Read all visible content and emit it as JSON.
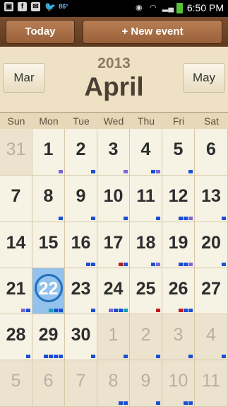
{
  "status_bar": {
    "time": "6:50 PM",
    "left_icons": [
      "image-icon",
      "facebook-icon",
      "mail-icon",
      "twitter-icon",
      "weather-icon"
    ],
    "temperature": "86°",
    "right_icons": [
      "eye-icon",
      "wifi-icon",
      "signal-icon",
      "battery-icon"
    ]
  },
  "toolbar": {
    "today_label": "Today",
    "new_event_label": "+ New event"
  },
  "header": {
    "prev_label": "Mar",
    "next_label": "May",
    "year": "2013",
    "month": "April"
  },
  "weekdays": [
    "Sun",
    "Mon",
    "Tue",
    "Wed",
    "Thu",
    "Fri",
    "Sat"
  ],
  "colors": {
    "blue": "#1a4fd6",
    "purple": "#7a66d9",
    "red": "#c21b1b",
    "teal": "#14a0b4",
    "today_bg": "#93c2ec",
    "today_ring": "#1f6fc0"
  },
  "weeks": [
    [
      {
        "day": "31",
        "other": true,
        "dots": []
      },
      {
        "day": "1",
        "other": false,
        "dots": [
          "purple"
        ]
      },
      {
        "day": "2",
        "other": false,
        "dots": [
          "blue"
        ]
      },
      {
        "day": "3",
        "other": false,
        "dots": [
          "purple"
        ]
      },
      {
        "day": "4",
        "other": false,
        "dots": [
          "blue",
          "purple"
        ]
      },
      {
        "day": "5",
        "other": false,
        "dots": [
          "blue"
        ]
      },
      {
        "day": "6",
        "other": false,
        "dots": []
      }
    ],
    [
      {
        "day": "7",
        "other": false,
        "dots": []
      },
      {
        "day": "8",
        "other": false,
        "dots": [
          "blue"
        ]
      },
      {
        "day": "9",
        "other": false,
        "dots": [
          "blue"
        ]
      },
      {
        "day": "10",
        "other": false,
        "dots": [
          "blue"
        ]
      },
      {
        "day": "11",
        "other": false,
        "dots": [
          "blue"
        ]
      },
      {
        "day": "12",
        "other": false,
        "dots": [
          "blue",
          "blue",
          "purple"
        ]
      },
      {
        "day": "13",
        "other": false,
        "dots": [
          "blue"
        ]
      }
    ],
    [
      {
        "day": "14",
        "other": false,
        "dots": []
      },
      {
        "day": "15",
        "other": false,
        "dots": []
      },
      {
        "day": "16",
        "other": false,
        "dots": [
          "blue",
          "blue"
        ]
      },
      {
        "day": "17",
        "other": false,
        "dots": [
          "red",
          "blue"
        ]
      },
      {
        "day": "18",
        "other": false,
        "dots": [
          "blue",
          "purple"
        ]
      },
      {
        "day": "19",
        "other": false,
        "dots": [
          "blue",
          "blue",
          "purple"
        ]
      },
      {
        "day": "20",
        "other": false,
        "dots": [
          "blue"
        ]
      }
    ],
    [
      {
        "day": "21",
        "other": false,
        "dots": [
          "purple",
          "blue"
        ]
      },
      {
        "day": "22",
        "other": false,
        "today": true,
        "dots": [
          "teal",
          "blue",
          "blue"
        ]
      },
      {
        "day": "23",
        "other": false,
        "dots": [
          "blue"
        ]
      },
      {
        "day": "24",
        "other": false,
        "dots": [
          "purple",
          "blue",
          "blue",
          "teal"
        ]
      },
      {
        "day": "25",
        "other": false,
        "dots": [
          "red"
        ]
      },
      {
        "day": "26",
        "other": false,
        "dots": [
          "red",
          "blue",
          "blue"
        ]
      },
      {
        "day": "27",
        "other": false,
        "dots": []
      }
    ],
    [
      {
        "day": "28",
        "other": false,
        "dots": [
          "blue"
        ]
      },
      {
        "day": "29",
        "other": false,
        "dots": [
          "blue",
          "blue",
          "blue",
          "blue"
        ]
      },
      {
        "day": "30",
        "other": false,
        "dots": [
          "blue"
        ]
      },
      {
        "day": "1",
        "other": true,
        "dots": [
          "blue"
        ]
      },
      {
        "day": "2",
        "other": true,
        "dots": [
          "blue"
        ]
      },
      {
        "day": "3",
        "other": true,
        "dots": [
          "blue"
        ]
      },
      {
        "day": "4",
        "other": true,
        "dots": [
          "blue"
        ]
      }
    ],
    [
      {
        "day": "5",
        "other": true,
        "dots": []
      },
      {
        "day": "6",
        "other": true,
        "dots": []
      },
      {
        "day": "7",
        "other": true,
        "dots": []
      },
      {
        "day": "8",
        "other": true,
        "dots": [
          "blue",
          "blue"
        ]
      },
      {
        "day": "9",
        "other": true,
        "dots": [
          "blue"
        ]
      },
      {
        "day": "10",
        "other": true,
        "dots": [
          "blue",
          "blue"
        ]
      },
      {
        "day": "11",
        "other": true,
        "dots": []
      }
    ]
  ]
}
